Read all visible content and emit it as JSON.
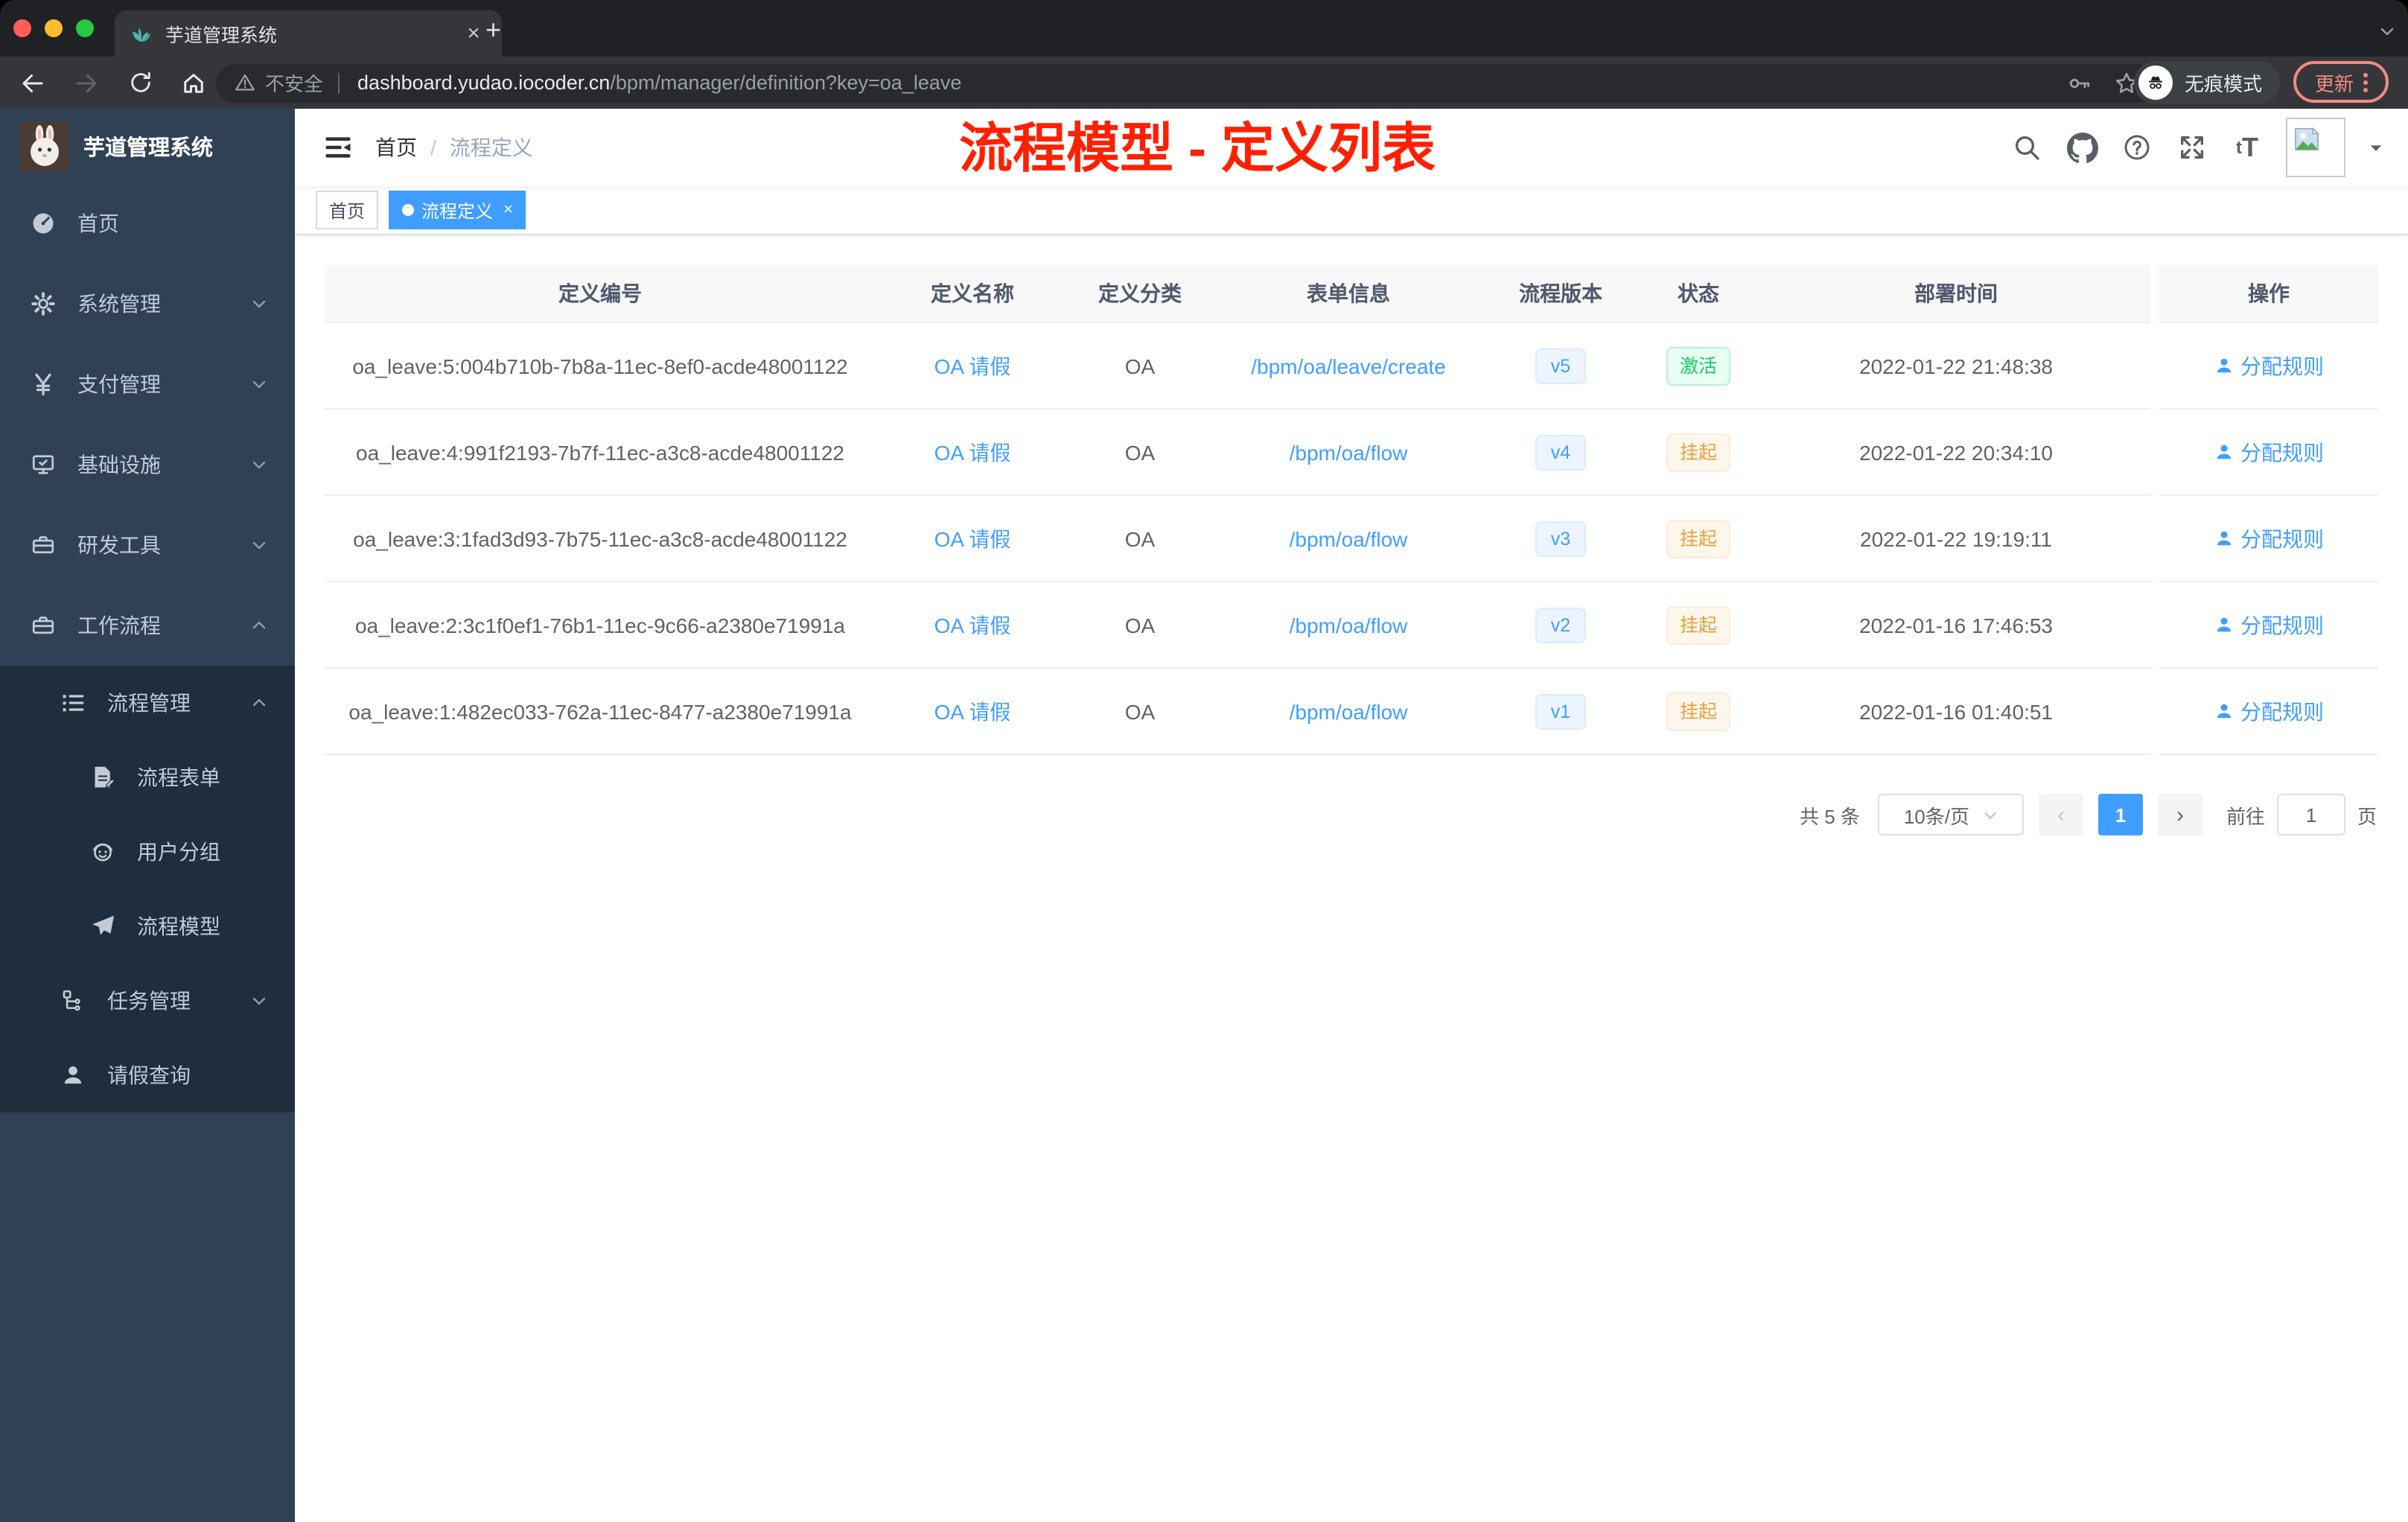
{
  "colors": {
    "accent": "#409eff",
    "annotation_red": "#ff2000",
    "sidebar_bg": "#304156",
    "sidebar_sub_bg": "#1f2d3d",
    "status_active_green": "#13ce66",
    "status_suspend_orange": "#e6a23c",
    "chrome_dark": "#202124",
    "update_pink": "#f28b82"
  },
  "browser": {
    "tab_title": "芋道管理系统",
    "close_tab_glyph": "×",
    "new_tab_glyph": "+",
    "security_label": "不安全",
    "url_domain": "dashboard.yudao.iocoder.cn",
    "url_path": "/bpm/manager/definition?key=oa_leave",
    "incognito_label": "无痕模式",
    "update_label": "更新"
  },
  "sidebar": {
    "logo_title": "芋道管理系统",
    "items": [
      {
        "label": "首页",
        "icon": "#i-gauge",
        "cls": "lvl0",
        "arrowCls": "arr-none"
      },
      {
        "label": "系统管理",
        "icon": "#i-gear",
        "cls": "lvl0",
        "arrowCls": "arr-down"
      },
      {
        "label": "支付管理",
        "icon": "#i-yen",
        "cls": "lvl0",
        "arrowCls": "arr-down"
      },
      {
        "label": "基础设施",
        "icon": "#i-monitor",
        "cls": "lvl0",
        "arrowCls": "arr-down"
      },
      {
        "label": "研发工具",
        "icon": "#i-toolbox",
        "cls": "lvl0",
        "arrowCls": "arr-down"
      },
      {
        "label": "工作流程",
        "icon": "#i-toolbox",
        "cls": "lvl0",
        "arrowCls": "arr-up"
      },
      {
        "label": "流程管理",
        "icon": "#i-list",
        "cls": "lvl1 sub",
        "arrowCls": "arr-up"
      },
      {
        "label": "流程表单",
        "icon": "#i-form",
        "cls": "lvl2 sub",
        "arrowCls": "arr-none"
      },
      {
        "label": "用户分组",
        "icon": "#i-robot",
        "cls": "lvl2 sub",
        "arrowCls": "arr-none"
      },
      {
        "label": "流程模型",
        "icon": "#i-send",
        "cls": "lvl2 sub",
        "arrowCls": "arr-none"
      },
      {
        "label": "任务管理",
        "icon": "#i-tree",
        "cls": "lvl1 sub",
        "arrowCls": "arr-down"
      },
      {
        "label": "请假查询",
        "icon": "#i-user",
        "cls": "lvl1 sub",
        "arrowCls": "arr-none"
      }
    ]
  },
  "navbar": {
    "breadcrumb_home": "首页",
    "breadcrumb_separator": "/",
    "breadcrumb_current": "流程定义",
    "annotation": "流程模型 - 定义列表"
  },
  "tags": [
    {
      "label": "首页",
      "cls": "",
      "close": "×"
    },
    {
      "label": "流程定义",
      "cls": "active",
      "close": "×"
    }
  ],
  "table": {
    "headers": {
      "id": "定义编号",
      "name": "定义名称",
      "category": "定义分类",
      "form": "表单信息",
      "version": "流程版本",
      "status": "状态",
      "deploy_time": "部署时间",
      "action": "操作"
    },
    "rows": [
      {
        "id": "oa_leave:5:004b710b-7b8a-11ec-8ef0-acde48001122",
        "name": "OA 请假",
        "category": "OA",
        "form": "/bpm/oa/leave/create",
        "version": "v5",
        "status": "激活",
        "status_cls": "t-success",
        "time": "2022-01-22 21:48:38",
        "action": "分配规则"
      },
      {
        "id": "oa_leave:4:991f2193-7b7f-11ec-a3c8-acde48001122",
        "name": "OA 请假",
        "category": "OA",
        "form": "/bpm/oa/flow",
        "version": "v4",
        "status": "挂起",
        "status_cls": "t-warning",
        "time": "2022-01-22 20:34:10",
        "action": "分配规则"
      },
      {
        "id": "oa_leave:3:1fad3d93-7b75-11ec-a3c8-acde48001122",
        "name": "OA 请假",
        "category": "OA",
        "form": "/bpm/oa/flow",
        "version": "v3",
        "status": "挂起",
        "status_cls": "t-warning",
        "time": "2022-01-22 19:19:11",
        "action": "分配规则"
      },
      {
        "id": "oa_leave:2:3c1f0ef1-76b1-11ec-9c66-a2380e71991a",
        "name": "OA 请假",
        "category": "OA",
        "form": "/bpm/oa/flow",
        "version": "v2",
        "status": "挂起",
        "status_cls": "t-warning",
        "time": "2022-01-16 17:46:53",
        "action": "分配规则"
      },
      {
        "id": "oa_leave:1:482ec033-762a-11ec-8477-a2380e71991a",
        "name": "OA 请假",
        "category": "OA",
        "form": "/bpm/oa/flow",
        "version": "v1",
        "status": "挂起",
        "status_cls": "t-warning",
        "time": "2022-01-16 01:40:51",
        "action": "分配规则"
      }
    ]
  },
  "pagination": {
    "total": "共 5 条",
    "page_size": "10条/页",
    "prev": "‹",
    "page": "1",
    "next": "›",
    "goto_label": "前往",
    "goto_value": "1",
    "unit": "页"
  }
}
